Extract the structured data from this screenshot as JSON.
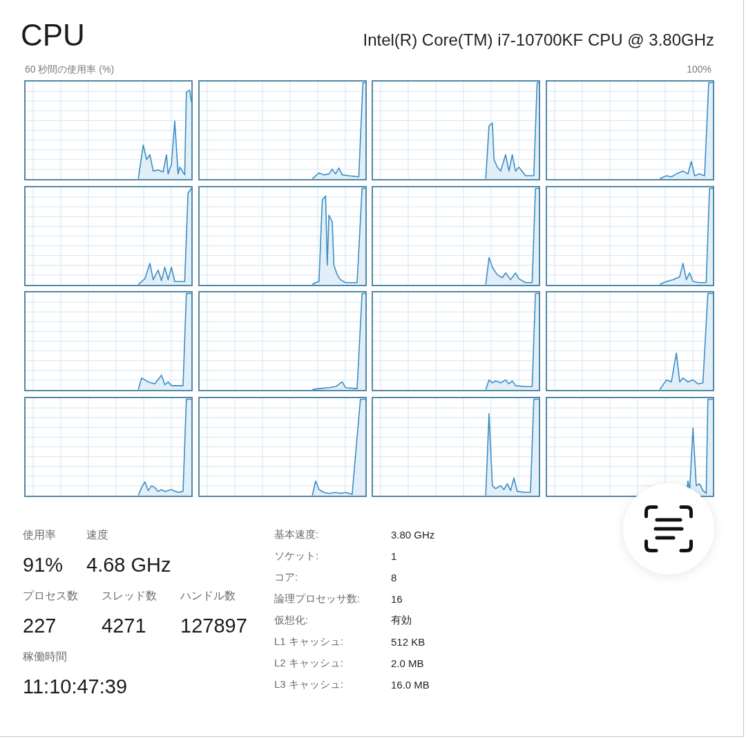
{
  "header": {
    "title": "CPU",
    "processor": "Intel(R) Core(TM) i7-10700KF CPU @ 3.80GHz"
  },
  "graph_panel": {
    "caption": "60 秒間の使用率 (%)",
    "max_label": "100%"
  },
  "stats": [
    {
      "items": [
        {
          "label": "使用率",
          "value": "91%"
        },
        {
          "label": "速度",
          "value": "4.68 GHz"
        }
      ]
    },
    {
      "items": [
        {
          "label": "プロセス数",
          "value": "227"
        },
        {
          "label": "スレッド数",
          "value": "4271"
        },
        {
          "label": "ハンドル数",
          "value": "127897"
        }
      ]
    },
    {
      "items": [
        {
          "label": "稼働時間",
          "value": "11:10:47:39"
        }
      ]
    }
  ],
  "details": [
    {
      "label": "基本速度:",
      "value": "3.80 GHz"
    },
    {
      "label": "ソケット:",
      "value": "1"
    },
    {
      "label": "コア:",
      "value": "8"
    },
    {
      "label": "論理プロセッサ数:",
      "value": "16"
    },
    {
      "label": "仮想化:",
      "value": "有効"
    },
    {
      "label": "L1 キャッシュ:",
      "value": "512 KB"
    },
    {
      "label": "L2 キャッシュ:",
      "value": "2.0 MB"
    },
    {
      "label": "L3 キャッシュ:",
      "value": "16.0 MB"
    }
  ]
}
